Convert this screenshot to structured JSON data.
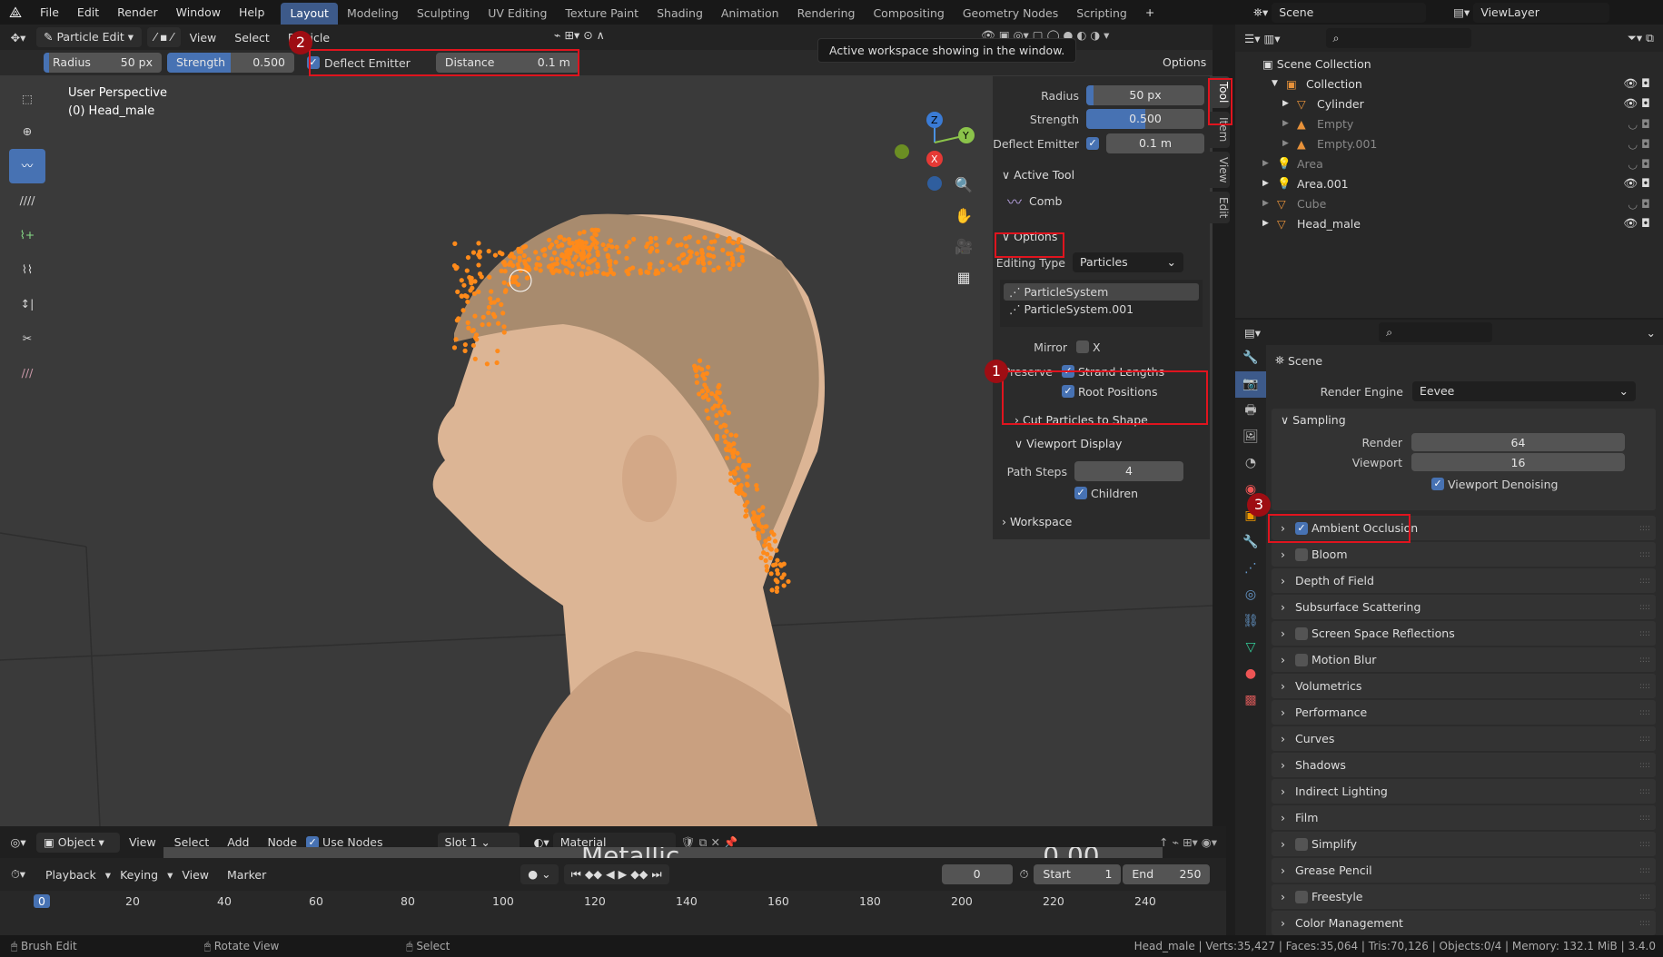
{
  "menu": [
    "File",
    "Edit",
    "Render",
    "Window",
    "Help"
  ],
  "workspaces": [
    {
      "label": "Layout",
      "active": true
    },
    {
      "label": "Modeling"
    },
    {
      "label": "Sculpting"
    },
    {
      "label": "UV Editing"
    },
    {
      "label": "Texture Paint"
    },
    {
      "label": "Shading"
    },
    {
      "label": "Animation"
    },
    {
      "label": "Rendering"
    },
    {
      "label": "Compositing"
    },
    {
      "label": "Geometry Nodes"
    },
    {
      "label": "Scripting"
    }
  ],
  "add_workspace": "+",
  "topright": {
    "scene": "Scene",
    "view_layer": "ViewLayer"
  },
  "viewport_header": {
    "mode": "Particle Edit",
    "menus": [
      "View",
      "Select",
      "Particle"
    ],
    "options": "Options"
  },
  "tooltip": "Active workspace showing in the window.",
  "tool_settings": {
    "radius_label": "Radius",
    "radius": "50 px",
    "strength_label": "Strength",
    "strength": "0.500",
    "deflect": "Deflect Emitter",
    "distance_label": "Distance",
    "distance": "0.1 m"
  },
  "viewport": {
    "perspective": "User Perspective",
    "object": "(0) Head_male",
    "gizmo": {
      "z": "Z",
      "y": "Y",
      "x": "X"
    }
  },
  "npanel": {
    "tabs": [
      "Tool",
      "Item",
      "View",
      "Edit"
    ],
    "radius_label": "Radius",
    "radius": "50 px",
    "strength_label": "Strength",
    "strength": "0.500",
    "deflect_label": "Deflect Emitter",
    "deflect_value": "0.1 m",
    "active_tool": "Active Tool",
    "tool_name": "Comb",
    "options": "Options",
    "editing_type_label": "Editing Type",
    "editing_type": "Particles",
    "systems": [
      "ParticleSystem",
      "ParticleSystem.001"
    ],
    "mirror_label": "Mirror",
    "mirror_x": "X",
    "preserve_label": "Preserve",
    "strand_lengths": "Strand Lengths",
    "root_positions": "Root Positions",
    "cut_particles": "Cut Particles to Shape",
    "viewport_display": "Viewport Display",
    "path_steps_label": "Path Steps",
    "path_steps": "4",
    "children": "Children",
    "workspace": "Workspace"
  },
  "badges": [
    "1",
    "2",
    "3"
  ],
  "outliner": {
    "root": "Scene Collection",
    "items": [
      {
        "name": "Collection",
        "level": 0,
        "dim": false
      },
      {
        "name": "Cylinder",
        "level": 1,
        "dim": false
      },
      {
        "name": "Empty",
        "level": 1,
        "dim": true
      },
      {
        "name": "Empty.001",
        "level": 1,
        "dim": true
      },
      {
        "name": "Area",
        "level": 0,
        "dim": true
      },
      {
        "name": "Area.001",
        "level": 0,
        "dim": false
      },
      {
        "name": "Cube",
        "level": 0,
        "dim": true
      },
      {
        "name": "Head_male",
        "level": 0,
        "dim": false
      }
    ]
  },
  "properties": {
    "scene": "Scene",
    "render_engine_label": "Render Engine",
    "render_engine": "Eevee",
    "sampling": "Sampling",
    "render_label": "Render",
    "render": "64",
    "viewport_label": "Viewport",
    "viewport": "16",
    "viewport_denoising": "Viewport Denoising",
    "panels": [
      {
        "label": "Ambient Occlusion",
        "checkbox": true,
        "checked": true
      },
      {
        "label": "Bloom",
        "checkbox": true,
        "checked": false
      },
      {
        "label": "Depth of Field"
      },
      {
        "label": "Subsurface Scattering"
      },
      {
        "label": "Screen Space Reflections",
        "checkbox": true,
        "checked": false
      },
      {
        "label": "Motion Blur",
        "checkbox": true,
        "checked": false
      },
      {
        "label": "Volumetrics"
      },
      {
        "label": "Performance"
      },
      {
        "label": "Curves"
      },
      {
        "label": "Shadows"
      },
      {
        "label": "Indirect Lighting"
      },
      {
        "label": "Film"
      },
      {
        "label": "Simplify",
        "checkbox": true,
        "checked": false
      },
      {
        "label": "Grease Pencil"
      },
      {
        "label": "Freestyle",
        "checkbox": true,
        "checked": false
      },
      {
        "label": "Color Management"
      }
    ]
  },
  "node_header": {
    "object": "Object",
    "menus": [
      "View",
      "Select",
      "Add",
      "Node"
    ],
    "use_nodes": "Use Nodes",
    "slot": "Slot 1",
    "material": "Material",
    "behind_text": "Metallic",
    "behind_value": "0.00"
  },
  "timeline": {
    "menus": [
      "Playback",
      "Keying",
      "View",
      "Marker"
    ],
    "current": "0",
    "start_label": "Start",
    "start": "1",
    "end_label": "End",
    "end": "250",
    "ticks": [
      "0",
      "20",
      "40",
      "60",
      "80",
      "100",
      "120",
      "140",
      "160",
      "180",
      "200",
      "220",
      "240"
    ]
  },
  "status": {
    "left": [
      "Brush Edit",
      "Rotate View",
      "Select"
    ],
    "right": "Head_male | Verts:35,427 | Faces:35,064 | Tris:70,126 | Objects:0/4 | Memory: 132.1 MiB | 3.4.0"
  },
  "colors": {
    "accent": "#4772b3",
    "highlight": "#e0141e",
    "badge": "#9e0d13",
    "particles": "#ff8a1a"
  }
}
